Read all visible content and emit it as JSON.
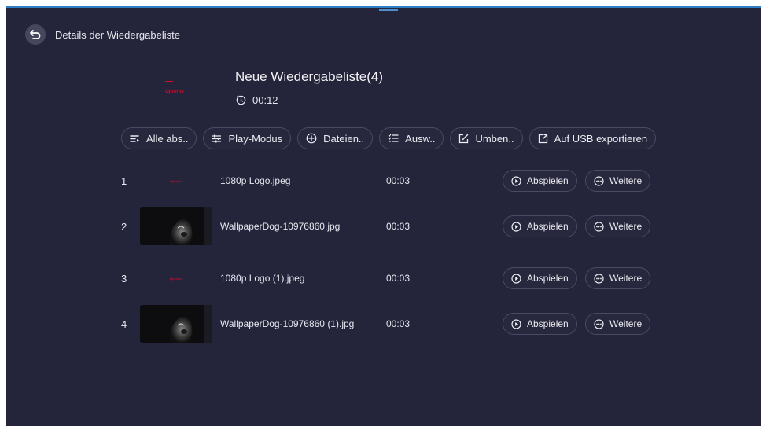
{
  "header": {
    "title": "Details der Wiedergabeliste"
  },
  "playlist": {
    "title": "Neue Wiedergabeliste(4)",
    "duration": "00:12",
    "logo_text": "Optoma"
  },
  "toolbar": {
    "buttons": [
      {
        "label": "Alle abs..",
        "icon": "select-all-icon"
      },
      {
        "label": "Play-Modus",
        "icon": "sliders-icon"
      },
      {
        "label": "Dateien..",
        "icon": "add-circle-icon"
      },
      {
        "label": "Ausw..",
        "icon": "checklist-icon"
      },
      {
        "label": "Umben..",
        "icon": "edit-icon"
      },
      {
        "label": "Auf USB exportieren",
        "icon": "export-icon"
      }
    ]
  },
  "items": [
    {
      "index": "1",
      "name": "1080p Logo.jpeg",
      "duration": "00:03",
      "thumb": "logo",
      "thumb_text": "Optoma",
      "play": "Abspielen",
      "more": "Weitere"
    },
    {
      "index": "2",
      "name": "WallpaperDog-10976860.jpg",
      "duration": "00:03",
      "thumb": "dog",
      "play": "Abspielen",
      "more": "Weitere"
    },
    {
      "index": "3",
      "name": "1080p Logo (1).jpeg",
      "duration": "00:03",
      "thumb": "logo",
      "thumb_text": "Optoma",
      "play": "Abspielen",
      "more": "Weitere"
    },
    {
      "index": "4",
      "name": "WallpaperDog-10976860 (1).jpg",
      "duration": "00:03",
      "thumb": "dog",
      "play": "Abspielen",
      "more": "Weitere"
    }
  ],
  "colors": {
    "background": "#24243a",
    "accent_border": "#2e7fc4",
    "logo_red": "#c8102e"
  }
}
